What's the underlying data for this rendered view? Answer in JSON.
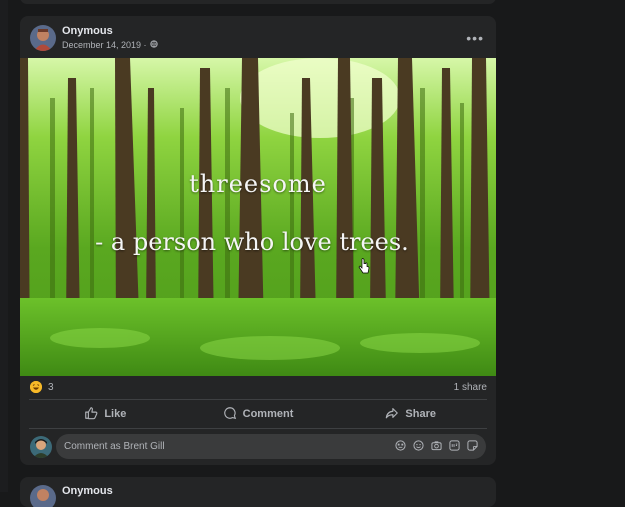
{
  "post": {
    "author": "Onymous",
    "date": "December 14, 2019 ·",
    "audience_icon": "globe-icon",
    "image": {
      "caption_line1": "threesome",
      "caption_line2": "- a person who love trees."
    },
    "reaction_icon": "haha-reaction-icon",
    "reaction_count": "3",
    "share_count": "1 share",
    "actions": {
      "like": "Like",
      "comment": "Comment",
      "share": "Share"
    },
    "comment_placeholder": "Comment as Brent Gill"
  },
  "next_post": {
    "author": "Onymous"
  },
  "colors": {
    "card": "#242526",
    "background": "#18191a",
    "text": "#e4e6eb",
    "muted": "#b0b3b8"
  }
}
